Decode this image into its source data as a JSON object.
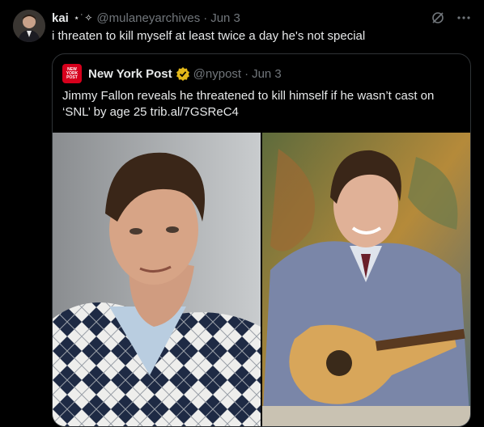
{
  "author": {
    "name": "kai",
    "decoration": "⋆˙✧",
    "handle": "@mulaneyarchives",
    "date": "Jun 3"
  },
  "tweet_text": "i threaten to kill myself at least twice a day he's not special",
  "quoted": {
    "name": "New York Post",
    "logo_text": "NEW YORK POST",
    "handle": "@nypost",
    "date": "Jun 3",
    "text": "Jimmy Fallon reveals he threatened to kill himself if he wasn’t cast on ‘SNL’ by age 25 trib.al/7GSReC4",
    "verified_color": "#e2b719"
  },
  "icons": {
    "more": "more-icon",
    "grok": "grok-icon",
    "verified": "verified-badge-icon"
  },
  "colors": {
    "background": "#000000",
    "text": "#e7e9ea",
    "secondary_text": "#71767b",
    "border": "#2f3336",
    "nypost_red": "#d6001c"
  }
}
